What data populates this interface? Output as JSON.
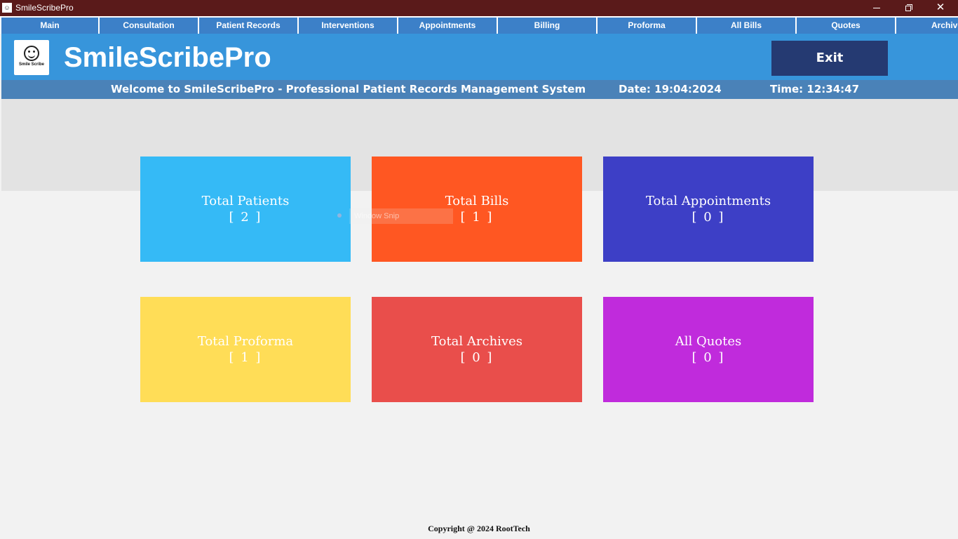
{
  "window": {
    "title": "SmileScribePro",
    "controls": {
      "minimize": "—",
      "maximize": "❐",
      "close": "✕"
    }
  },
  "nav": {
    "items": [
      {
        "label": "Main"
      },
      {
        "label": "Consultation"
      },
      {
        "label": "Patient Records"
      },
      {
        "label": "Interventions"
      },
      {
        "label": "Appointments"
      },
      {
        "label": "Billing"
      },
      {
        "label": "Proforma"
      },
      {
        "label": "All Bills"
      },
      {
        "label": "Quotes"
      },
      {
        "label": "Archive"
      }
    ]
  },
  "header": {
    "app_name": "SmileScribePro",
    "logo_text": "Smile Scribe",
    "exit_label": "Exit"
  },
  "status": {
    "welcome": "Welcome to SmileScribePro - Professional Patient Records Management System",
    "date": "Date: 19:04:2024",
    "time": "Time: 12:34:47"
  },
  "cards": [
    {
      "title": "Total Patients",
      "count": "[ 2 ]",
      "color": "#35baf6"
    },
    {
      "title": "Total Bills",
      "count": "[ 1 ]",
      "color": "#ff5722"
    },
    {
      "title": "Total Appointments",
      "count": "[ 0 ]",
      "color": "#3d3fc6"
    },
    {
      "title": "Total Proforma",
      "count": "[ 1 ]",
      "color": "#ffdd57"
    },
    {
      "title": "Total Archives",
      "count": "[ 0 ]",
      "color": "#e94e4b"
    },
    {
      "title": "All Quotes",
      "count": "[ 0 ]",
      "color": "#c02bdc"
    }
  ],
  "overlay": {
    "snip_label": "Window Snip"
  },
  "footer": {
    "copyright": "Copyright @ 2024 RootTech"
  }
}
